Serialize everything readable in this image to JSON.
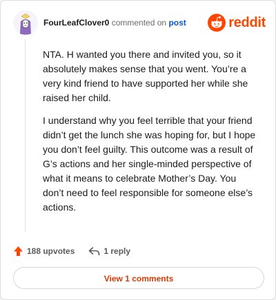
{
  "comment": {
    "author": "FourLeafClover0",
    "action_text": "commented on",
    "post_link_label": "post",
    "paragraphs": [
      "NTA. H wanted you there and invited you, so it absolutely makes sense that you went. You’re a very kind friend to have supported her while she raised her child.",
      "I understand why you feel terrible that your friend didn’t get the lunch she was hoping for, but I hope you don’t feel guilty. This outcome was a result of G’s actions and her single-minded perspective of what it means to celebrate Mother’s Day. You don’t need to feel responsible for someone else’s actions."
    ]
  },
  "brand": {
    "name": "reddit",
    "color": "#ff4500"
  },
  "actions": {
    "upvotes_label": "188 upvotes",
    "upvote_icon": "upvote-arrow-icon",
    "reply_label": "1 reply",
    "reply_icon": "reply-arrow-icon"
  },
  "footer": {
    "view_comments_label": "View 1 comments"
  },
  "colors": {
    "accent": "#ff4500",
    "link": "#0a58ca",
    "text": "#1a1a1b",
    "muted": "#5a5a5a"
  }
}
